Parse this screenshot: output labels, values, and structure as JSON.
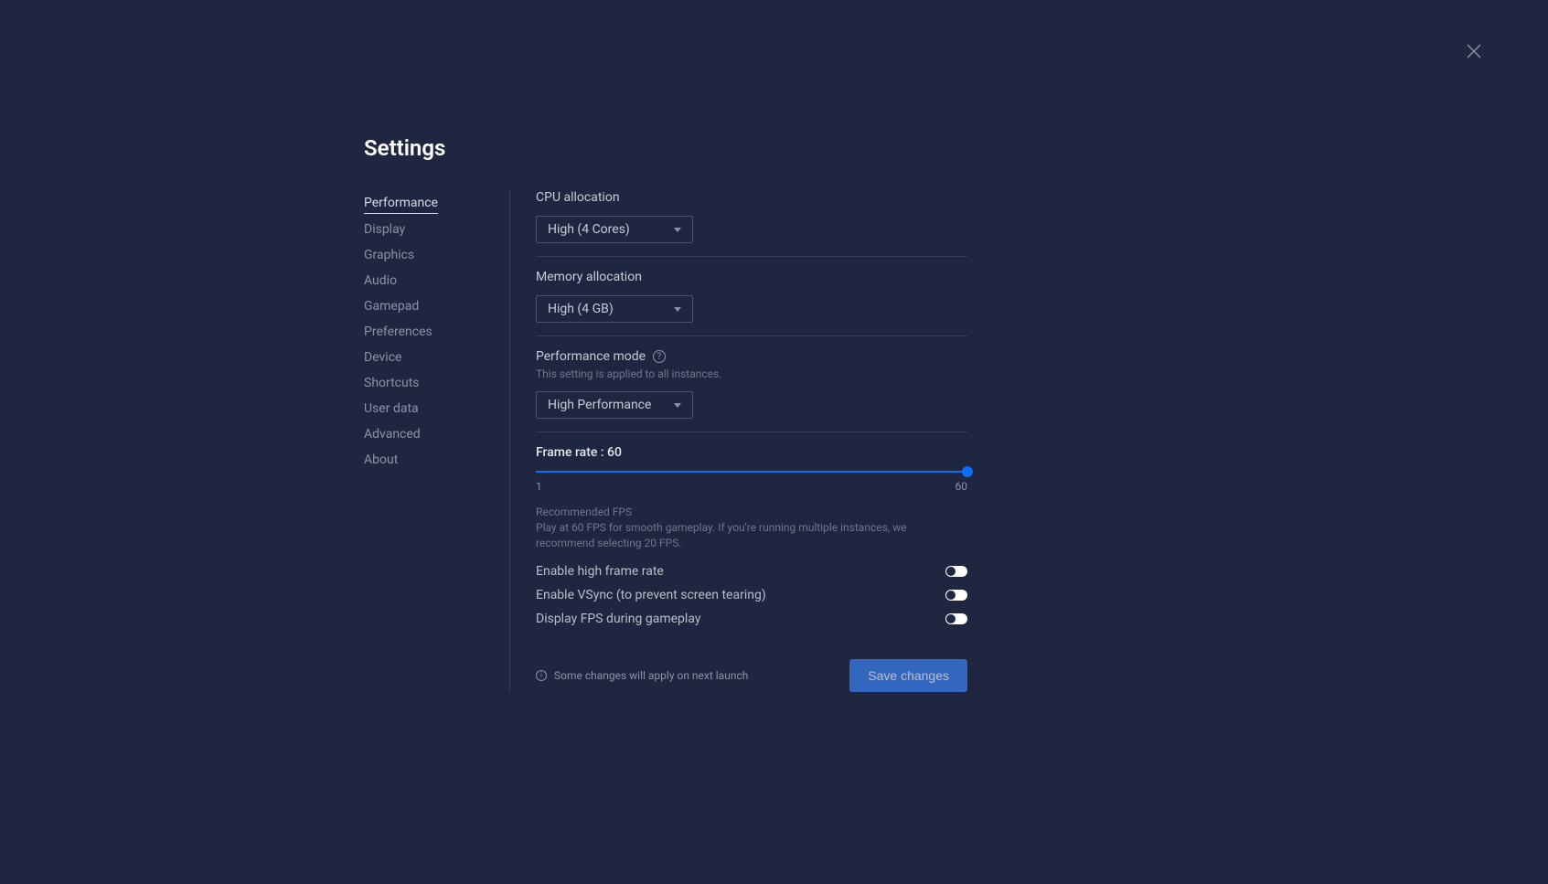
{
  "title": "Settings",
  "sidebar": {
    "items": [
      {
        "label": "Performance",
        "active": true
      },
      {
        "label": "Display",
        "active": false
      },
      {
        "label": "Graphics",
        "active": false
      },
      {
        "label": "Audio",
        "active": false
      },
      {
        "label": "Gamepad",
        "active": false
      },
      {
        "label": "Preferences",
        "active": false
      },
      {
        "label": "Device",
        "active": false
      },
      {
        "label": "Shortcuts",
        "active": false
      },
      {
        "label": "User data",
        "active": false
      },
      {
        "label": "Advanced",
        "active": false
      },
      {
        "label": "About",
        "active": false
      }
    ]
  },
  "cpu": {
    "label": "CPU allocation",
    "value": "High (4 Cores)"
  },
  "memory": {
    "label": "Memory allocation",
    "value": "High (4 GB)"
  },
  "perfmode": {
    "label": "Performance mode",
    "subtext": "This setting is applied to all instances.",
    "value": "High Performance"
  },
  "framerate": {
    "label": "Frame rate : 60",
    "min": "1",
    "max": "60",
    "recommended_title": "Recommended FPS",
    "recommended_text": "Play at 60 FPS for smooth gameplay. If you're running multiple instances, we recommend selecting 20 FPS."
  },
  "toggles": {
    "high_frame": "Enable high frame rate",
    "vsync": "Enable VSync (to prevent screen tearing)",
    "display_fps": "Display FPS during gameplay"
  },
  "footer": {
    "note": "Some changes will apply on next launch",
    "save": "Save changes"
  }
}
